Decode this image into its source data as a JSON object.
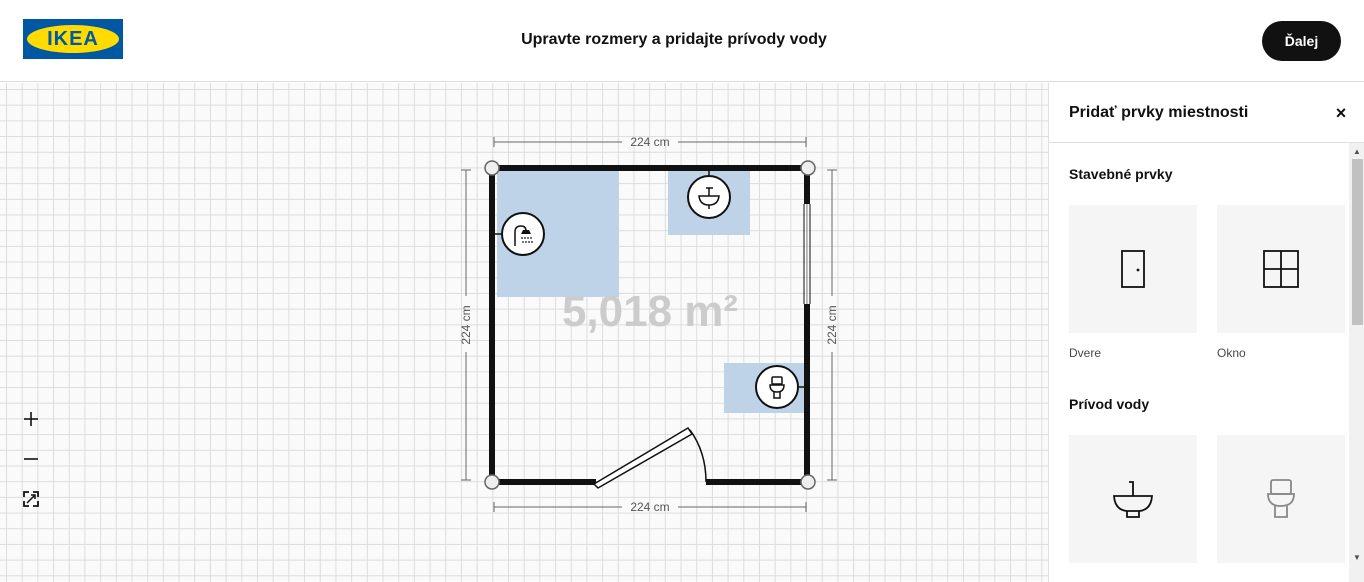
{
  "header": {
    "logo_text": "IKEA",
    "title": "Upravte rozmery a pridajte prívody vody",
    "next_label": "Ďalej"
  },
  "plan": {
    "area": "5,018 m²",
    "dim_top": "224 cm",
    "dim_bottom": "224 cm",
    "dim_left": "224 cm",
    "dim_right": "224 cm",
    "fixtures": [
      "shower-icon",
      "sink-icon",
      "toilet-icon"
    ],
    "zone_color": "#bfd3e8"
  },
  "zoom": {
    "zoom_in": "+",
    "zoom_out": "−"
  },
  "panel": {
    "title": "Pridať prvky miestnosti",
    "close": "×",
    "sections": [
      {
        "title": "Stavebné prvky",
        "items": [
          {
            "label": "Dvere",
            "icon": "door-icon"
          },
          {
            "label": "Okno",
            "icon": "window-icon"
          }
        ]
      },
      {
        "title": "Prívod vody",
        "items": [
          {
            "label": "",
            "icon": "sink-icon"
          },
          {
            "label": "",
            "icon": "toilet-icon"
          }
        ]
      }
    ]
  },
  "colors": {
    "brand_blue": "#0058a3",
    "brand_yellow": "#ffdb00",
    "button_bg": "#111111"
  }
}
